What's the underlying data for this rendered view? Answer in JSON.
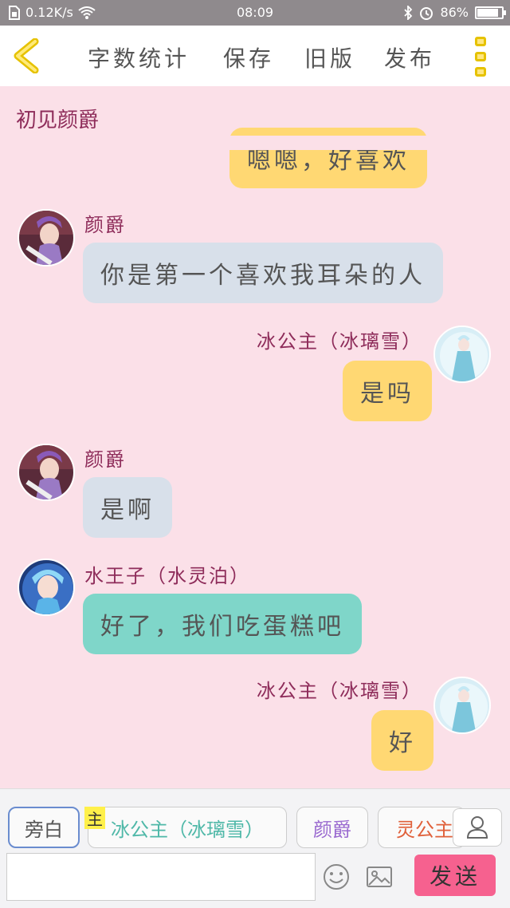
{
  "status_bar": {
    "speed": "0.12K/s",
    "time": "08:09",
    "battery_percent": "86%",
    "battery_level": 0.86
  },
  "toolbar": {
    "word_count": "字数统计",
    "save": "保存",
    "old_version": "旧版",
    "publish": "发布"
  },
  "chat": {
    "title": "初见颜爵",
    "messages": [
      {
        "side": "right",
        "text": "嗯嗯，好喜欢",
        "color": "#ffd873"
      },
      {
        "side": "left",
        "speaker": "颜爵",
        "text": "你是第一个喜欢我耳朵的人",
        "color": "#d8e0ea"
      },
      {
        "side": "right",
        "speaker": "冰公主（冰璃雪）",
        "text": "是吗",
        "color": "#ffd873"
      },
      {
        "side": "left",
        "speaker": "颜爵",
        "text": "是啊",
        "color": "#d8e0ea"
      },
      {
        "side": "left",
        "speaker": "水王子（水灵泊）",
        "text": "好了，我们吃蛋糕吧",
        "color": "#7fd6c9"
      },
      {
        "side": "right",
        "speaker": "冰公主（冰璃雪）",
        "text": "好",
        "color": "#ffd873"
      }
    ]
  },
  "roles": {
    "narrator": "旁白",
    "main_badge": "主",
    "ice_princess": "冰公主（冰璃雪）",
    "yanjue": "颜爵",
    "ling_princess": "灵公主"
  },
  "input": {
    "value": "",
    "send": "发送"
  },
  "colors": {
    "background": "#fbe0e8",
    "name_color": "#8e2c5a",
    "send_button": "#f6618f"
  }
}
